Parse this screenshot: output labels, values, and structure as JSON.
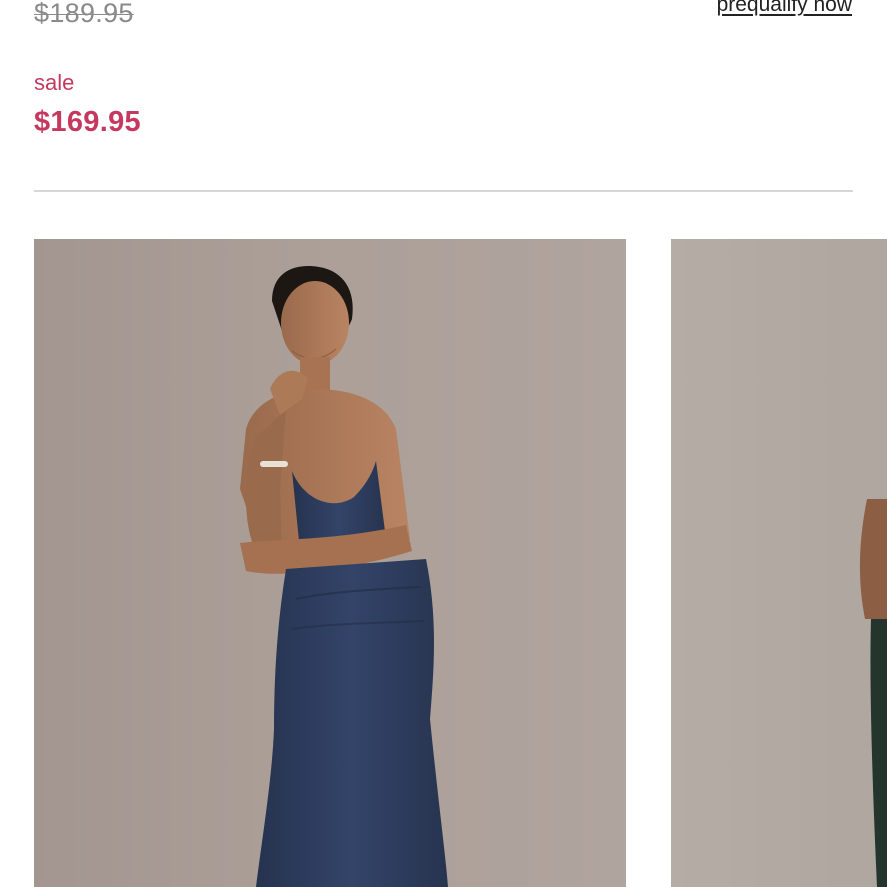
{
  "pricing": {
    "original_price": "$189.95",
    "prequalify_link": "prequalify now",
    "sale_label": "sale",
    "sale_price": "$169.95"
  },
  "colors": {
    "sale_accent": "#c5395f",
    "divider": "#d7d7d7",
    "photo_backdrop": "#aa9e97",
    "dress_navy": "#2e3d5e"
  },
  "gallery": {
    "images": [
      {
        "subject": "model-navy-cowl-neck-satin-gown"
      },
      {
        "subject": "model-dark-green-gown-partial"
      }
    ]
  }
}
